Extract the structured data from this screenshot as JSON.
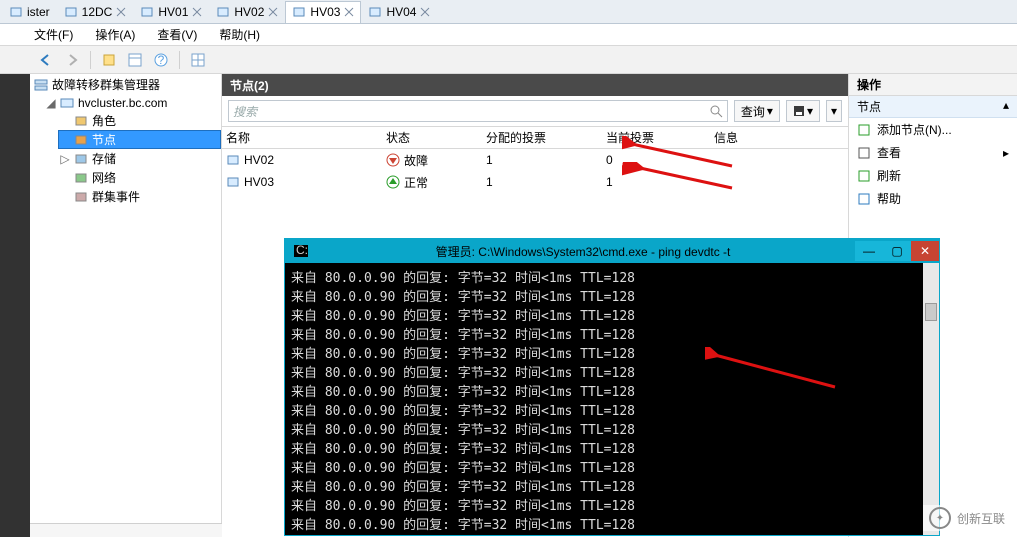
{
  "tabs": [
    {
      "label": "ister",
      "active": false,
      "icon": "node"
    },
    {
      "label": "12DC",
      "active": false,
      "icon": "server"
    },
    {
      "label": "HV01",
      "active": false,
      "icon": "server"
    },
    {
      "label": "HV02",
      "active": false,
      "icon": "server"
    },
    {
      "label": "HV03",
      "active": true,
      "icon": "server"
    },
    {
      "label": "HV04",
      "active": false,
      "icon": "folder"
    }
  ],
  "menu": [
    "文件(F)",
    "操作(A)",
    "查看(V)",
    "帮助(H)"
  ],
  "tree": {
    "root": "故障转移群集管理器",
    "cluster": "hvcluster.bc.com",
    "children": [
      "角色",
      "节点",
      "存储",
      "网络",
      "群集事件"
    ]
  },
  "nodes_panel": {
    "title": "节点(2)",
    "search_placeholder": "搜索",
    "query_btn": "查询",
    "columns": [
      "名称",
      "状态",
      "分配的投票",
      "当前投票",
      "信息"
    ],
    "rows": [
      {
        "name": "HV02",
        "state": "故障",
        "state_kind": "fail",
        "assigned": "1",
        "current": "0",
        "info": ""
      },
      {
        "name": "HV03",
        "state": "正常",
        "state_kind": "ok",
        "assigned": "1",
        "current": "1",
        "info": ""
      }
    ]
  },
  "actions": {
    "title": "操作",
    "subtitle": "节点",
    "items": [
      {
        "label": "添加节点(N)...",
        "icon": "add-node"
      },
      {
        "label": "查看",
        "icon": "view",
        "sub": true
      },
      {
        "label": "刷新",
        "icon": "refresh"
      },
      {
        "label": "帮助",
        "icon": "help"
      }
    ]
  },
  "cmd": {
    "title": "管理员: C:\\Windows\\System32\\cmd.exe - ping  devdtc -t",
    "lines": [
      "来自 80.0.0.90 的回复: 字节=32 时间<1ms TTL=128",
      "来自 80.0.0.90 的回复: 字节=32 时间<1ms TTL=128",
      "来自 80.0.0.90 的回复: 字节=32 时间<1ms TTL=128",
      "来自 80.0.0.90 的回复: 字节=32 时间<1ms TTL=128",
      "来自 80.0.0.90 的回复: 字节=32 时间<1ms TTL=128",
      "来自 80.0.0.90 的回复: 字节=32 时间<1ms TTL=128",
      "来自 80.0.0.90 的回复: 字节=32 时间<1ms TTL=128",
      "来自 80.0.0.90 的回复: 字节=32 时间<1ms TTL=128",
      "来自 80.0.0.90 的回复: 字节=32 时间<1ms TTL=128",
      "来自 80.0.0.90 的回复: 字节=32 时间<1ms TTL=128",
      "来自 80.0.0.90 的回复: 字节=32 时间<1ms TTL=128",
      "来自 80.0.0.90 的回复: 字节=32 时间<1ms TTL=128",
      "来自 80.0.0.90 的回复: 字节=32 时间<1ms TTL=128",
      "来自 80.0.0.90 的回复: 字节=32 时间<1ms TTL=128",
      "来自 80.0.0.90 的回复: 字节=32 时间<1ms TTL=128",
      "来自 80.0.0.90 的回复: 字节=32 时间<1ms TTL=128",
      "来自 80.0.0.90 的回复: 字节=32 时间<1ms TTL=128",
      "来自 80.0.0.90 的回复: 字节=32 时间<1ms TTL=128",
      "来自 80.0.0.90 的回复: 字节=32 时间<1ms TTL=128"
    ]
  },
  "watermark": "创新互联"
}
